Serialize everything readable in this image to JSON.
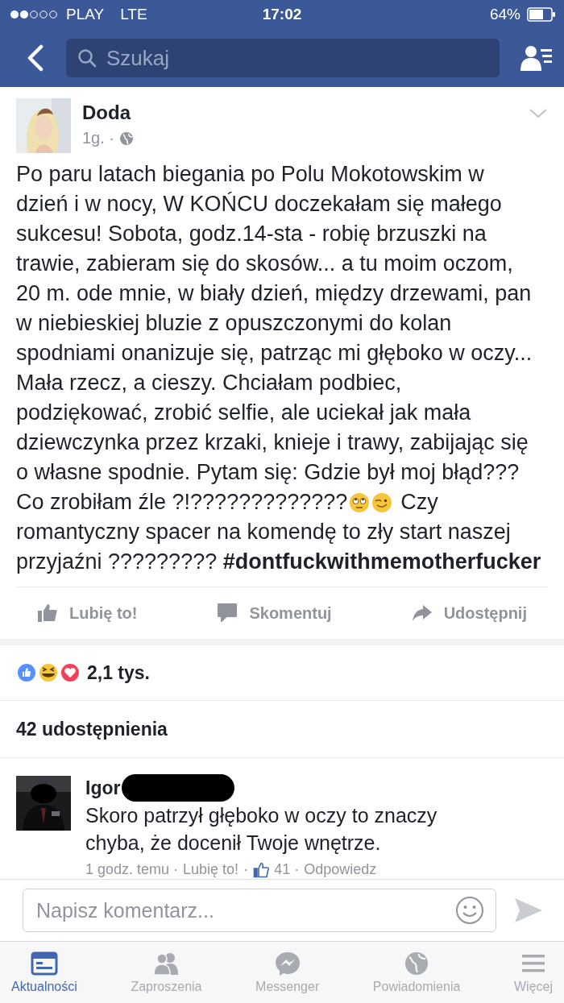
{
  "status_bar": {
    "carrier": "PLAY",
    "network": "LTE",
    "time": "17:02",
    "battery": "64%"
  },
  "nav": {
    "search_placeholder": "Szukaj"
  },
  "post": {
    "author": "Doda",
    "time": "1g. ·",
    "lines": [
      {
        "kind": "text",
        "text": "Po paru latach biegania po Polu Mokotowskim w"
      },
      {
        "kind": "text",
        "text": "dzień i w nocy, W KOŃCU doczekałam się małego"
      },
      {
        "kind": "text",
        "text": "sukcesu! Sobota, godz.14-sta - robię brzuszki na"
      },
      {
        "kind": "text",
        "text": "trawie, zabieram się do skosów... a tu moim oczom,"
      },
      {
        "kind": "text",
        "text": "20 m. ode mnie, w biały dzień, między drzewami, pan"
      },
      {
        "kind": "text",
        "text": "w niebieskiej bluzie z opuszczonymi do kolan"
      },
      {
        "kind": "text",
        "text": "spodniami onanizuje się, patrząc mi głęboko w oczy..."
      },
      {
        "kind": "text",
        "text": "Mała rzecz, a cieszy. Chciałam podbiec,"
      },
      {
        "kind": "text",
        "text": "podziękować, zrobić selfie, ale uciekał jak mała"
      },
      {
        "kind": "text",
        "text": "dziewczynka przez krzaki, knieje i trawy, zabijając się"
      },
      {
        "kind": "text",
        "text": "o własne spodnie. Pytam się: Gdzie był moj błąd???"
      },
      {
        "kind": "emoji",
        "before": "Co zrobiłam źle ?!?????????????",
        "after": "Czy"
      },
      {
        "kind": "text",
        "text": "romantyczny spacer na komendę to zły start naszej"
      },
      {
        "kind": "text",
        "text": "przyjaźni ????????? **#dontfuckwithmemotherfucker**"
      }
    ]
  },
  "actions": [
    {
      "kind": "like",
      "label": "Lubię to!"
    },
    {
      "kind": "comment",
      "label": "Skomentuj"
    },
    {
      "kind": "share",
      "label": "Udostępnij"
    }
  ],
  "reactions": {
    "count": "2,1 tys."
  },
  "shares": "42 udostępnienia",
  "comment": {
    "author": "Igor",
    "text": "Skoro patrzył głęboko w oczy to znaczy chyba, że docenił Twoje wnętrze.",
    "time": "1 godz. temu ·",
    "like_link": "Lubię to!",
    "separator": "·",
    "likes": "41 ·",
    "reply_link": "Odpowiedz"
  },
  "composer": {
    "placeholder": "Napisz komentarz..."
  },
  "tabs": [
    {
      "kind": "news",
      "label": "Aktualności",
      "selected": true
    },
    {
      "kind": "friends",
      "label": "Zaproszenia",
      "selected": false
    },
    {
      "kind": "messenger",
      "label": "Messenger",
      "selected": false
    },
    {
      "kind": "globe",
      "label": "Powiadomienia",
      "selected": false
    },
    {
      "kind": "menu",
      "label": "Więcej",
      "selected": false
    }
  ]
}
